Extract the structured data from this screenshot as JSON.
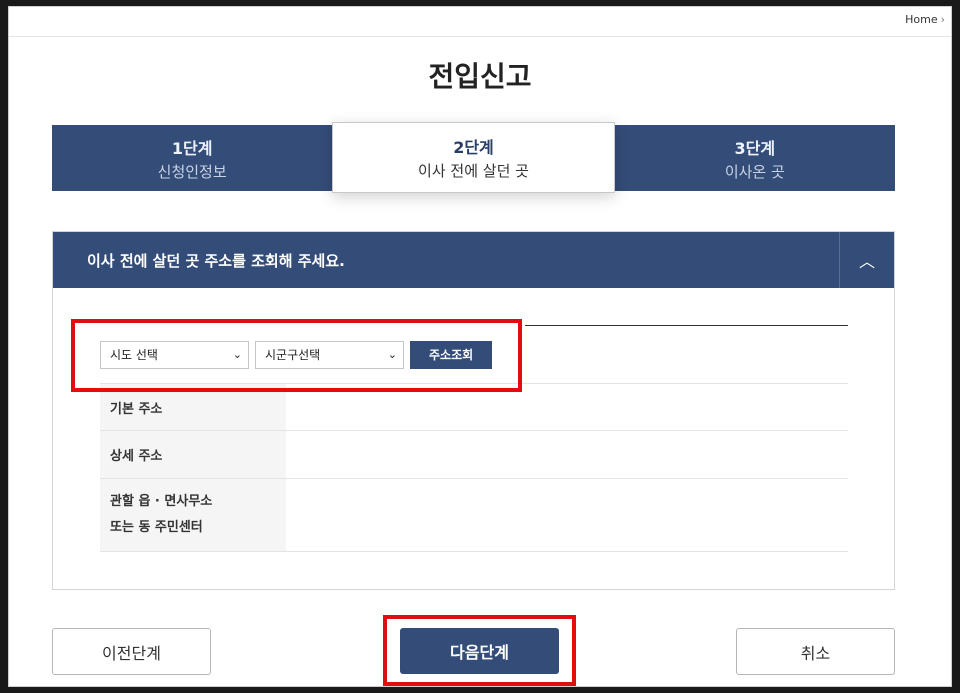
{
  "topbar": {
    "home_label": "Home",
    "home_chevron": "›"
  },
  "page": {
    "title": "전입신고"
  },
  "steps": [
    {
      "num": "1단계",
      "label": "신청인정보",
      "active": false
    },
    {
      "num": "2단계",
      "label": "이사 전에 살던 곳",
      "active": true
    },
    {
      "num": "3단계",
      "label": "이사온 곳",
      "active": false
    }
  ],
  "panel": {
    "title": "이사 전에 살던 곳 주소를 조회해 주세요.",
    "toggle_icon": "chevron-up-icon",
    "toggle_glyph": "︿"
  },
  "search": {
    "sido_value": "시도 선택",
    "sigungu_value": "시군구선택",
    "button_label": "주소조회",
    "caret_glyph": "⌄"
  },
  "fields": [
    {
      "label": "기본 주소",
      "value": ""
    },
    {
      "label": "상세 주소",
      "value": ""
    },
    {
      "label_line1": "관할 읍 · 면사무소",
      "label_line2": "또는 동 주민센터",
      "value": ""
    }
  ],
  "actions": {
    "prev_label": "이전단계",
    "next_label": "다음단계",
    "cancel_label": "취소"
  },
  "colors": {
    "primary": "#344c78",
    "highlight": "#e20d0d"
  }
}
